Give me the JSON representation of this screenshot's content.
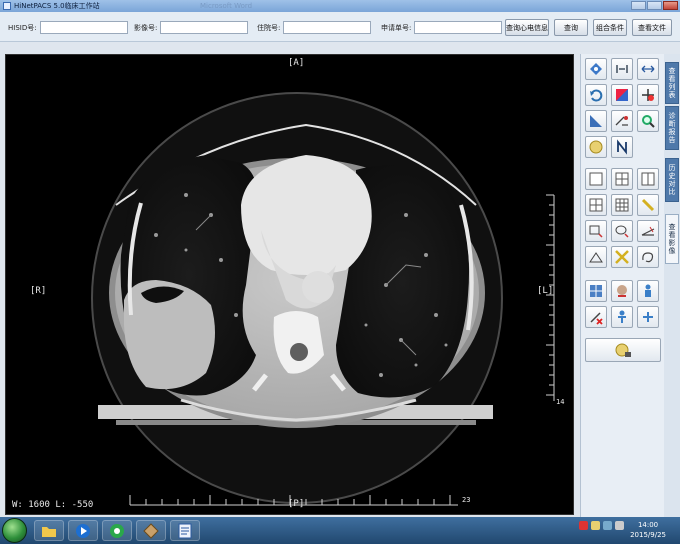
{
  "window": {
    "title": "HiNetPACS 5.0临床工作站",
    "ghost_text": "Microsoft Word"
  },
  "search": {
    "hisid_label": "HISID号:",
    "hisid_value": "",
    "image_no_label": "影像号:",
    "image_no_value": "",
    "inpatient_label": "住院号:",
    "inpatient_value": "",
    "request_label": "申请单号:",
    "request_value": "",
    "ecg_query_button": "查询心电信息",
    "query_button": "查询",
    "combo_button": "组合条件",
    "view_file_button": "查看文件"
  },
  "viewer": {
    "orientation_top": "[A]",
    "orientation_bottom": "[P]",
    "orientation_left": "[R]",
    "orientation_right": "[L]",
    "window_info": "W: 1600  L: -550",
    "scale_bottom_number": "23",
    "scale_right_number": "14"
  },
  "tabs": [
    {
      "label": "查看列表",
      "active": false
    },
    {
      "label": "诊断报告",
      "active": false
    },
    {
      "label": "历史对比",
      "active": false
    },
    {
      "label": "查看影像",
      "active": true
    }
  ],
  "tools": [
    "select-tool-icon",
    "fit-width-icon",
    "fit-horizontal-icon",
    "rotate-icon",
    "invert-icon",
    "window-level-icon",
    "measure-angle-icon",
    "annotation-icon",
    "magnifier-icon",
    "reset-icon",
    "orientation-north-icon",
    "layout-1x1-icon",
    "layout-2x2-icon",
    "layout-1x2-icon",
    "layout-2x2-alt-icon",
    "layout-3x3-icon",
    "line-measure-icon",
    "rect-roi-icon",
    "ellipse-roi-icon",
    "angle-measure-icon",
    "area-measure-icon",
    "cross-line-icon",
    "freehand-roi-icon",
    "mpr-icon",
    "volume-render-icon",
    "body-model-icon",
    "delete-annotation-icon",
    "body-position-icon",
    "localizer-icon",
    "export-icon"
  ],
  "taskbar": {
    "time": "14:00",
    "date": "2015/9/25"
  },
  "colors": {
    "titlebar": "#7aa5d8",
    "tab_blue": "#4f79aa",
    "taskbar": "#2c5580"
  }
}
